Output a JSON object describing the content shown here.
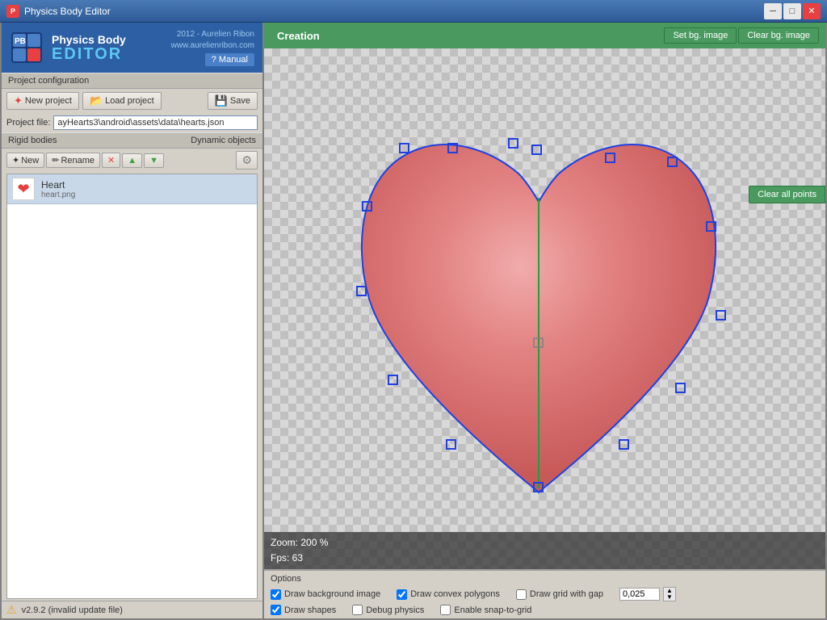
{
  "window": {
    "title": "Physics Body Editor",
    "icon": "⚙"
  },
  "logo": {
    "title": "Physics Body",
    "subtitle": "EDITOR",
    "year": "2012 - Aurelien Ribon",
    "website": "www.aurelienribon.com",
    "manual_label": "? Manual"
  },
  "project": {
    "section_label": "Project configuration",
    "new_label": "New project",
    "load_label": "Load project",
    "save_label": "Save",
    "file_label": "Project file:",
    "file_value": "ayHearts3\\android\\assets\\data\\hearts.json"
  },
  "rigid_bodies": {
    "section_label": "Rigid bodies",
    "dynamic_label": "Dynamic objects",
    "new_label": "New",
    "rename_label": "Rename",
    "items": [
      {
        "name": "Heart",
        "file": "heart.png",
        "icon": "❤"
      }
    ]
  },
  "canvas": {
    "creation_label": "Creation",
    "set_bg_label": "Set bg. image",
    "clear_bg_label": "Clear bg. image",
    "clear_points_label": "Clear all points",
    "zoom_label": "Zoom: 200 %",
    "fps_label": "Fps: 63"
  },
  "options": {
    "section_label": "Options",
    "draw_bg": {
      "label": "Draw background image",
      "checked": true
    },
    "draw_convex": {
      "label": "Draw convex polygons",
      "checked": true
    },
    "draw_grid_gap": {
      "label": "Draw grid with gap",
      "checked": false
    },
    "draw_shapes": {
      "label": "Draw shapes",
      "checked": true
    },
    "debug_physics": {
      "label": "Debug physics",
      "checked": false
    },
    "enable_snap": {
      "label": "Enable snap-to-grid",
      "checked": false
    },
    "grid_value": "0,025"
  },
  "status": {
    "icon": "⚠",
    "text": "v2.9.2 (invalid update file)"
  }
}
